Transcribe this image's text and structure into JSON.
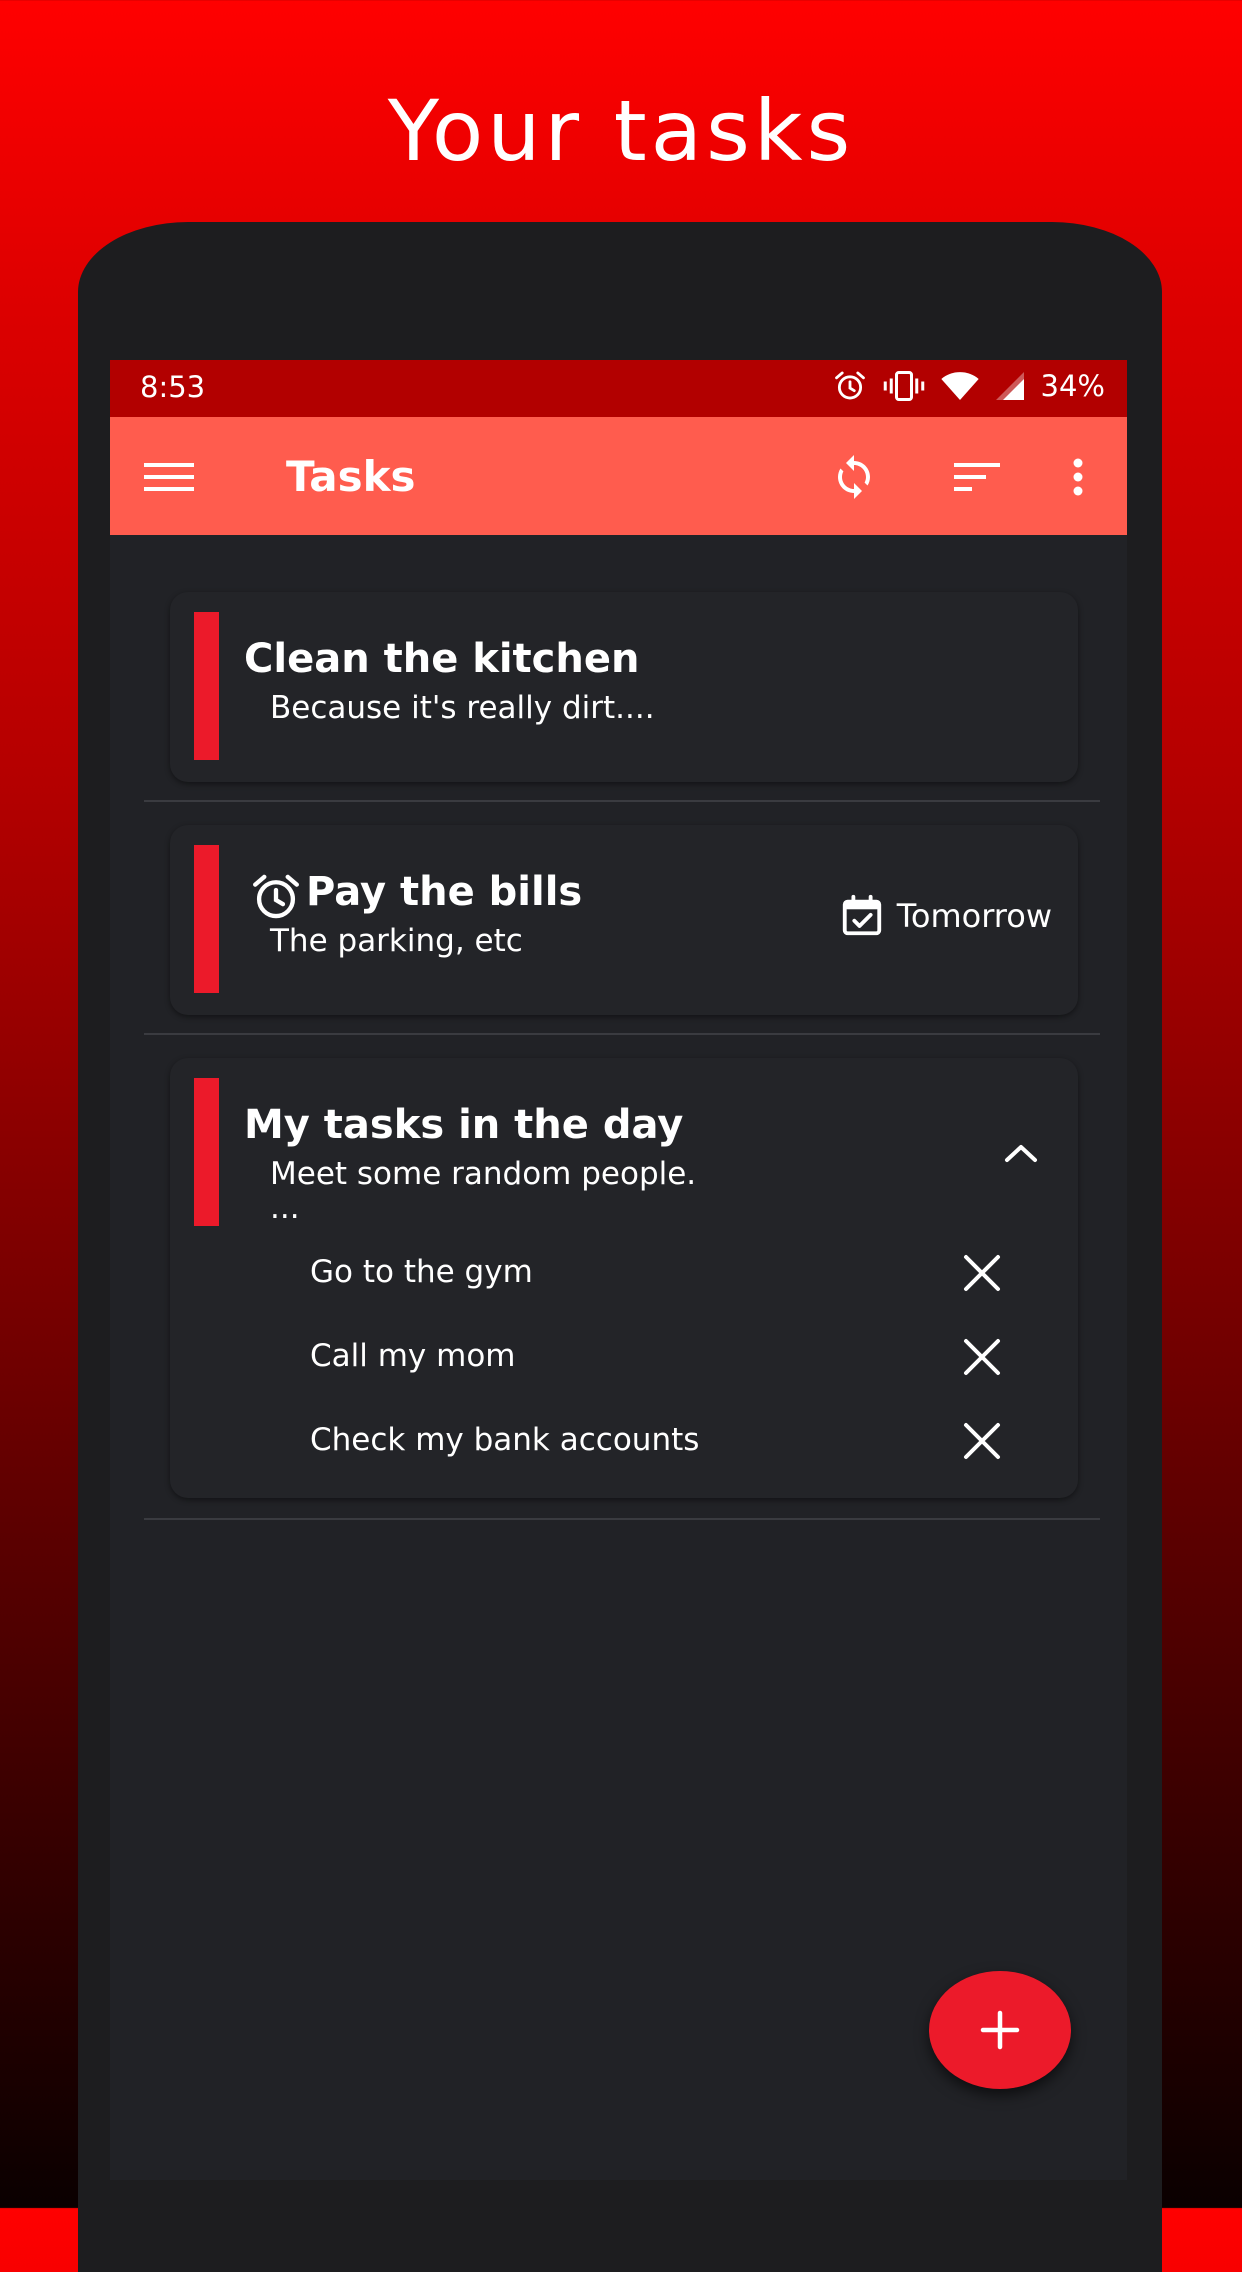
{
  "promo": {
    "headline": "Your tasks"
  },
  "status_bar": {
    "time": "8:53",
    "battery": "34%",
    "icons": [
      "alarm-icon",
      "vibrate-icon",
      "wifi-icon",
      "signal-icon"
    ]
  },
  "app_bar": {
    "title": "Tasks",
    "icons": [
      "menu-icon",
      "sync-icon",
      "sort-icon",
      "more-vert-icon"
    ]
  },
  "tasks": [
    {
      "title": "Clean the kitchen",
      "description": "Because it's really dirt....",
      "priority_color": "#ec1a2a"
    },
    {
      "title": "Pay the bills",
      "description": "The parking, etc",
      "has_reminder": true,
      "due": "Tomorrow",
      "priority_color": "#ec1a2a"
    },
    {
      "title": "My tasks in the day",
      "description": "Meet some random people.",
      "description_more": "...",
      "expanded": true,
      "priority_color": "#ec1a2a",
      "subtasks": [
        {
          "label": "Go to the gym"
        },
        {
          "label": "Call my mom"
        },
        {
          "label": "Check my bank accounts"
        }
      ]
    }
  ],
  "fab": {
    "icon": "add-icon"
  },
  "colors": {
    "app_bar": "#ff5c4e",
    "status_bar": "#b20000",
    "accent": "#ec1a2a",
    "background": "#212226"
  }
}
